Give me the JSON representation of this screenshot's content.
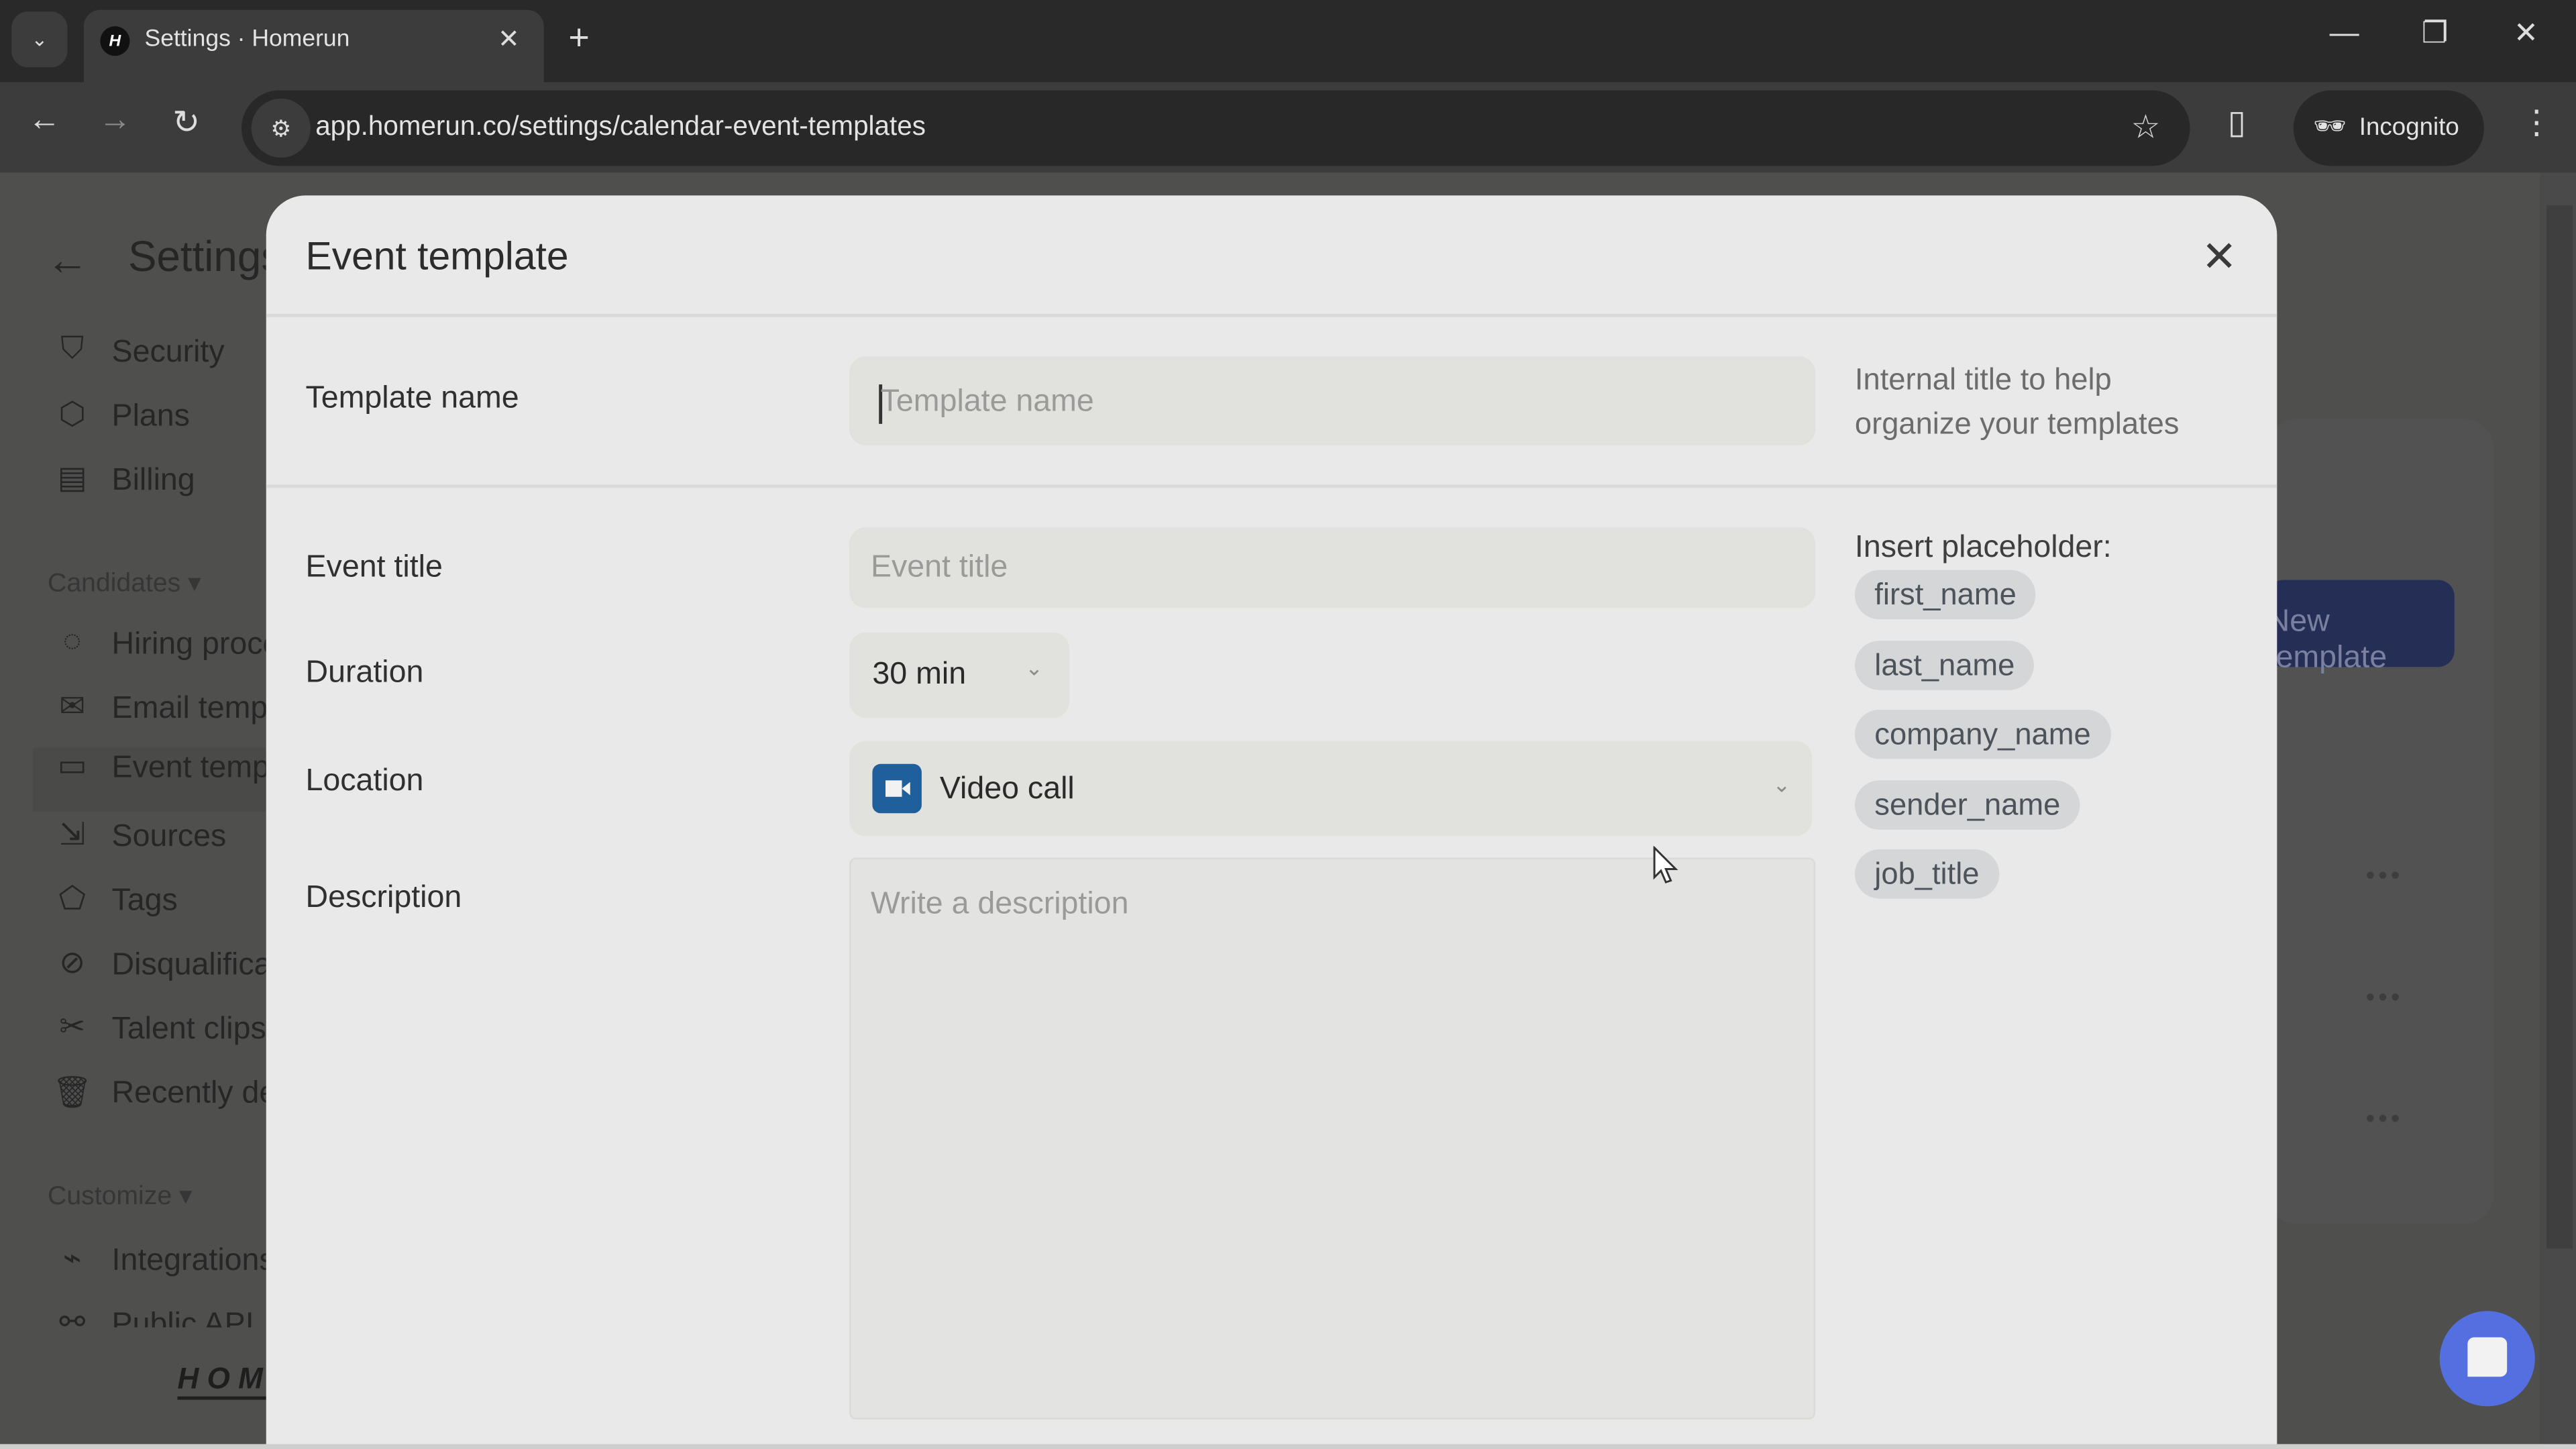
{
  "browser": {
    "tab_title": "Settings · Homerun",
    "favicon_letter": "H",
    "url": "app.homerun.co/settings/calendar-event-templates",
    "incognito_label": "Incognito",
    "icons": {
      "tab_search": "chevron-down-icon",
      "new_tab": "plus-icon",
      "minimize": "minimize-icon",
      "restore": "restore-icon",
      "close": "close-icon",
      "back": "arrow-left-icon",
      "forward": "arrow-right-icon",
      "reload": "reload-icon",
      "site_info": "tune-icon",
      "bookmark": "star-icon",
      "side_panel": "side-panel-icon",
      "menu": "kebab-menu-icon"
    },
    "glyphs": {
      "tab_search": "⌄",
      "tab_close": "✕",
      "new_tab": "+",
      "minimize": "—",
      "restore": "❐",
      "close": "✕",
      "back": "←",
      "forward": "→",
      "reload": "↻",
      "site_info": "⚙",
      "bookmark": "☆",
      "side_panel": "▯",
      "incognito": "🕶",
      "menu": "⋮"
    }
  },
  "sidebar": {
    "title": "Settings",
    "back_glyph": "←",
    "items_top": [
      {
        "label": "Security",
        "icon": "shield-star-icon",
        "glyph": "⛉"
      },
      {
        "label": "Plans",
        "icon": "box-icon",
        "glyph": "⬡"
      },
      {
        "label": "Billing",
        "icon": "receipt-icon",
        "glyph": "▤"
      }
    ],
    "section_candidates": "Candidates ▾",
    "items_candidates": [
      {
        "label": "Hiring process",
        "icon": "hiring-process-icon",
        "glyph": "◌"
      },
      {
        "label": "Email templates",
        "icon": "envelope-icon",
        "glyph": "✉"
      },
      {
        "label": "Event templates",
        "icon": "calendar-icon",
        "glyph": "▭"
      },
      {
        "label": "Sources",
        "icon": "sources-icon",
        "glyph": "⇲"
      },
      {
        "label": "Tags",
        "icon": "tag-icon",
        "glyph": "⬠"
      },
      {
        "label": "Disqualification reasons",
        "icon": "ban-icon",
        "glyph": "⊘"
      },
      {
        "label": "Talent clips",
        "icon": "scissors-icon",
        "glyph": "✂"
      },
      {
        "label": "Recently deleted",
        "icon": "trash-icon",
        "glyph": "🗑"
      }
    ],
    "section_customize": "Customize ▾",
    "items_customize": [
      {
        "label": "Integrations",
        "icon": "plug-icon",
        "glyph": "⌁"
      },
      {
        "label": "Public API",
        "icon": "api-icon",
        "glyph": "⚯"
      }
    ],
    "logo": "HOMERUN"
  },
  "background": {
    "new_template_button": "New template",
    "row_menu_glyph": "•••"
  },
  "modal": {
    "title": "Event template",
    "close_glyph": "✕",
    "fields": {
      "template_name": {
        "label": "Template name",
        "placeholder": "Template name",
        "value": ""
      },
      "template_name_hint": [
        "Internal title to help",
        "organize your templates"
      ],
      "event_title": {
        "label": "Event title",
        "placeholder": "Event title",
        "value": ""
      },
      "duration": {
        "label": "Duration",
        "value": "30 min",
        "chevron": "⌄"
      },
      "location": {
        "label": "Location",
        "value": "Video call",
        "icon": "video-camera-icon",
        "chevron": "⌄"
      },
      "description": {
        "label": "Description",
        "placeholder": "Write a description",
        "value": ""
      }
    },
    "placeholders": {
      "title": "Insert placeholder:",
      "chips": [
        "first_name",
        "last_name",
        "company_name",
        "sender_name",
        "job_title"
      ]
    }
  },
  "colors": {
    "modal_bg": "#e9e9e9",
    "input_bg": "#e1e1de",
    "chip_bg": "#d4d6d8",
    "video_icon": "#1f5f9c",
    "chat_button": "#5470e0",
    "primary_button_dimmed": "#252f56"
  }
}
